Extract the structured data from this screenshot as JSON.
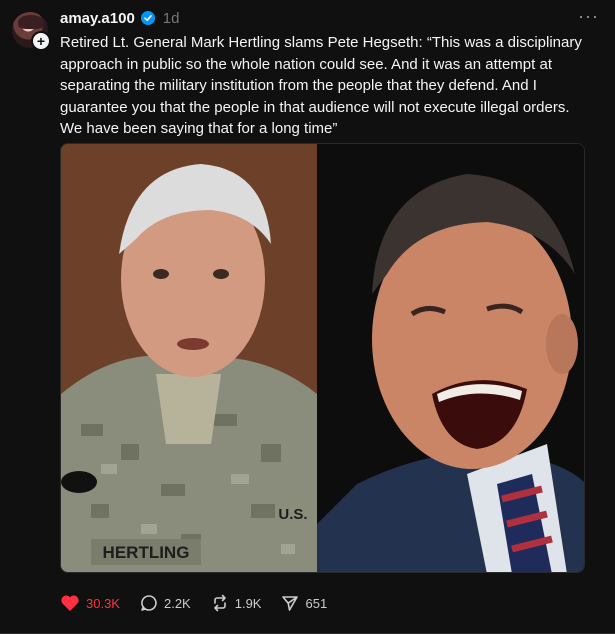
{
  "post": {
    "username": "amay.a100",
    "time": "1d",
    "text": "Retired Lt. General Mark Hertling slams Pete Hegseth: “This was a disciplinary approach in public so the whole nation could see. And it was an attempt at separating the military institution from the people that they defend. And I guarantee you that the people in that audience will not execute illegal orders. We have been saying that for a long time”",
    "media": {
      "left_name_tag": "HERTLING",
      "left_patch": "U.S."
    }
  },
  "actions": {
    "likes": "30.3K",
    "replies": "2.2K",
    "reposts": "1.9K",
    "shares": "651"
  },
  "colors": {
    "background": "#101010",
    "like_red": "#ff3040",
    "verified_blue": "#0095f6",
    "muted": "#777777"
  }
}
